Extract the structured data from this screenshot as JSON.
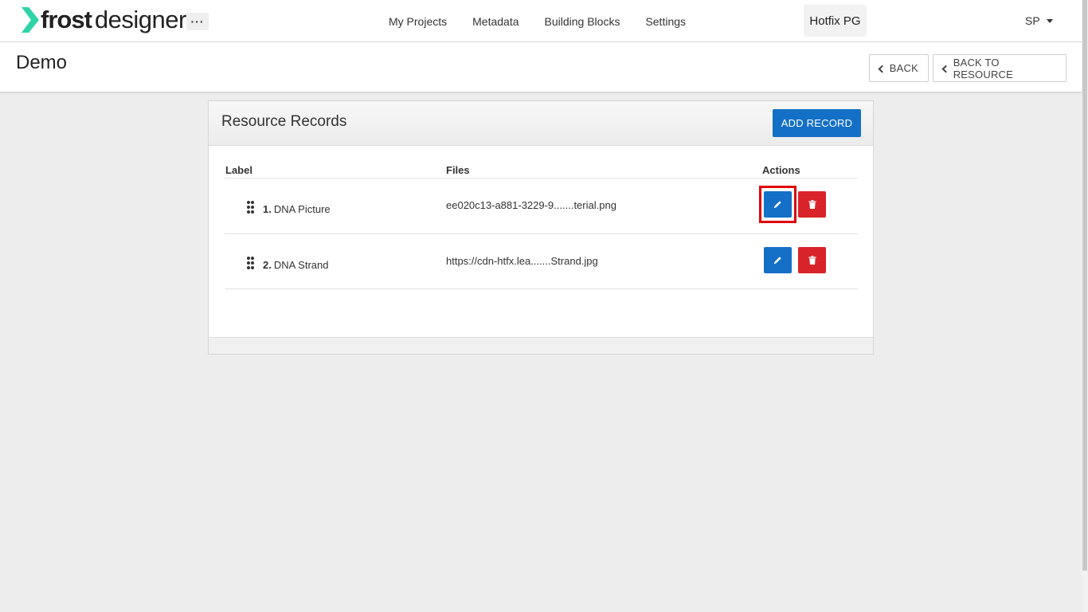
{
  "app": {
    "logo_primary": "frost",
    "logo_secondary": "designer",
    "more_label": "···",
    "brand_color": "#2fd3a8"
  },
  "nav": {
    "items": [
      {
        "label": "My Projects"
      },
      {
        "label": "Metadata"
      },
      {
        "label": "Building Blocks"
      },
      {
        "label": "Settings"
      }
    ]
  },
  "project": {
    "label": "Hotfix PG"
  },
  "user": {
    "initials": "SP"
  },
  "page": {
    "title": "Demo",
    "back_label": "BACK",
    "back_to_resource_label": "BACK TO RESOURCE"
  },
  "panel": {
    "title": "Resource Records",
    "add_label": "ADD RECORD",
    "columns": {
      "label": "Label",
      "files": "Files",
      "actions": "Actions"
    },
    "rows": [
      {
        "index": "1.",
        "label": "DNA Picture",
        "file": "ee020c13-a881-3229-9.......terial.png"
      },
      {
        "index": "2.",
        "label": "DNA Strand",
        "file": "https://cdn-htfx.lea.......Strand.jpg"
      }
    ]
  },
  "colors": {
    "primary": "#1470c6",
    "danger": "#d9232a",
    "highlight": "#e00000"
  }
}
